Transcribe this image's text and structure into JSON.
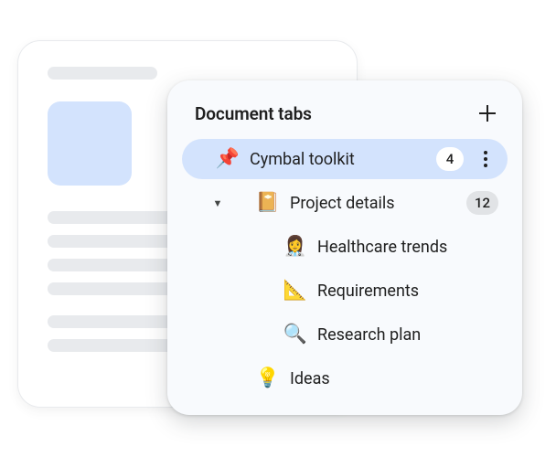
{
  "panel": {
    "title": "Document tabs"
  },
  "tabs": [
    {
      "icon": "📌",
      "label": "Cymbal toolkit",
      "count": "4",
      "active": true,
      "hasMore": true,
      "level": 1,
      "caret": ""
    },
    {
      "icon": "📔",
      "label": "Project details",
      "count": "12",
      "active": false,
      "hasMore": false,
      "level": 2,
      "caret": "▼"
    },
    {
      "icon": "👩‍⚕️",
      "label": "Healthcare trends",
      "count": "",
      "active": false,
      "hasMore": false,
      "level": 3,
      "caret": ""
    },
    {
      "icon": "📐",
      "label": "Requirements",
      "count": "",
      "active": false,
      "hasMore": false,
      "level": 3,
      "caret": ""
    },
    {
      "icon": "🔍",
      "label": "Research plan",
      "count": "",
      "active": false,
      "hasMore": false,
      "level": 3,
      "caret": ""
    },
    {
      "icon": "💡",
      "label": "Ideas",
      "count": "",
      "active": false,
      "hasMore": false,
      "level": 2,
      "caret": ""
    }
  ]
}
